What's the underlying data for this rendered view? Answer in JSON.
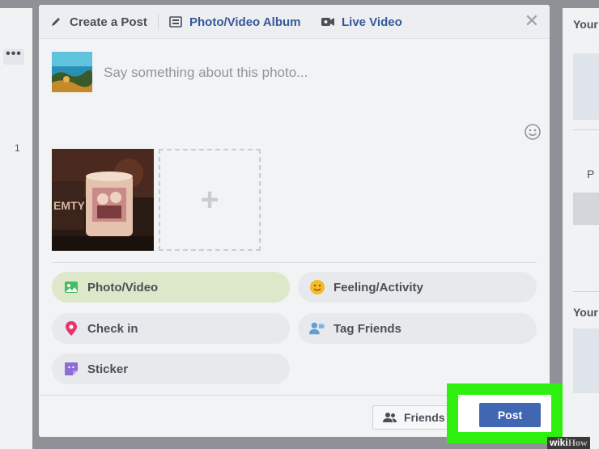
{
  "background": {
    "right_text_top": "Your",
    "right_text_mid": "P",
    "right_text_bottom": "Your",
    "left_number": "1"
  },
  "modal": {
    "tabs": [
      {
        "label": "Create a Post",
        "icon": "pencil-icon"
      },
      {
        "label": "Photo/Video Album",
        "icon": "album-icon"
      },
      {
        "label": "Live Video",
        "icon": "video-camera-icon"
      }
    ],
    "composer": {
      "placeholder": "Say something about this photo..."
    },
    "options": [
      {
        "label": "Photo/Video",
        "icon": "photo-icon",
        "color": "#45bd62"
      },
      {
        "label": "Feeling/Activity",
        "icon": "smiley-icon",
        "color": "#f7b928"
      },
      {
        "label": "Check in",
        "icon": "location-pin-icon",
        "color": "#e9346a"
      },
      {
        "label": "Tag Friends",
        "icon": "tag-friends-icon",
        "color": "#5f9fd4"
      },
      {
        "label": "Sticker",
        "icon": "sticker-icon",
        "color": "#8c6cd6"
      }
    ],
    "footer": {
      "audience_label": "Friends",
      "post_label": "Post"
    }
  },
  "colors": {
    "accent": "#4267b2",
    "link": "#365899",
    "highlight": "#2ef00e"
  },
  "watermark": {
    "part1": "wiki",
    "part2": "How"
  }
}
